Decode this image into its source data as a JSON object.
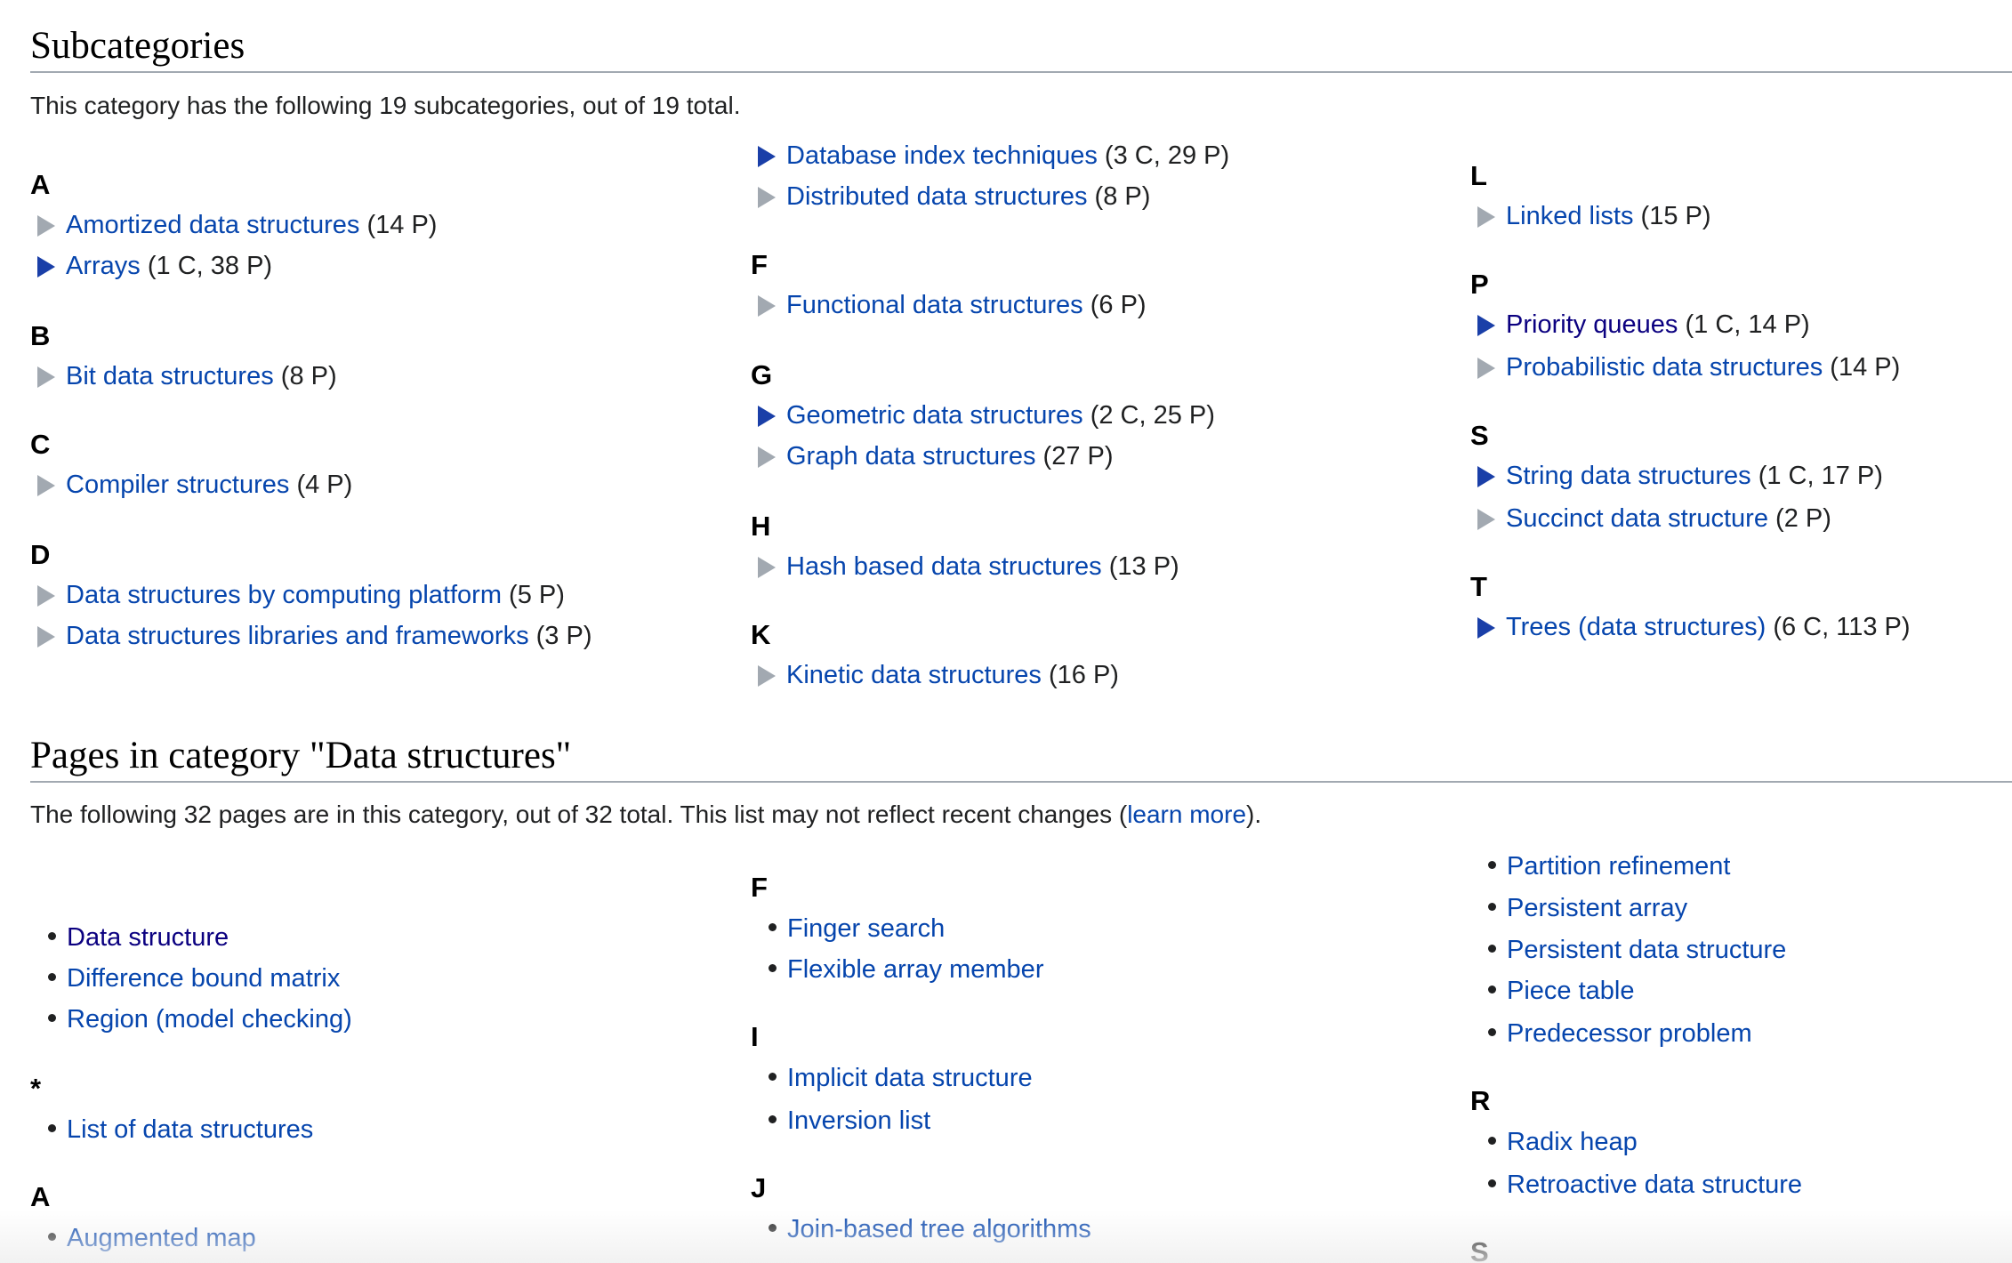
{
  "subcategories": {
    "title": "Subcategories",
    "description": "This category has the following 19 subcategories, out of 19 total.",
    "columns": [
      [
        {
          "letter": "A"
        },
        {
          "label": "Amortized data structures",
          "count": "(14 P)",
          "expandable": false
        },
        {
          "label": "Arrays",
          "count": "(1 C, 38 P)",
          "expandable": true
        },
        {
          "letter": "B"
        },
        {
          "label": "Bit data structures",
          "count": "(8 P)",
          "expandable": false
        },
        {
          "letter": "C"
        },
        {
          "label": "Compiler structures",
          "count": "(4 P)",
          "expandable": false
        },
        {
          "letter": "D"
        },
        {
          "label": "Data structures by computing platform",
          "count": "(5 P)",
          "expandable": false
        },
        {
          "label": "Data structures libraries and frameworks",
          "count": "(3 P)",
          "expandable": false
        }
      ],
      [
        {
          "label": "Database index techniques",
          "count": "(3 C, 29 P)",
          "expandable": true
        },
        {
          "label": "Distributed data structures",
          "count": "(8 P)",
          "expandable": false
        },
        {
          "letter": "F"
        },
        {
          "label": "Functional data structures",
          "count": "(6 P)",
          "expandable": false
        },
        {
          "letter": "G"
        },
        {
          "label": "Geometric data structures",
          "count": "(2 C, 25 P)",
          "expandable": true
        },
        {
          "label": "Graph data structures",
          "count": "(27 P)",
          "expandable": false
        },
        {
          "letter": "H"
        },
        {
          "label": "Hash based data structures",
          "count": "(13 P)",
          "expandable": false
        },
        {
          "letter": "K"
        },
        {
          "label": "Kinetic data structures",
          "count": "(16 P)",
          "expandable": false
        }
      ],
      [
        {
          "letter": "L"
        },
        {
          "label": "Linked lists",
          "count": "(15 P)",
          "expandable": false
        },
        {
          "letter": "P"
        },
        {
          "label": "Priority queues",
          "count": "(1 C, 14 P)",
          "expandable": true,
          "visited": true
        },
        {
          "label": "Probabilistic data structures",
          "count": "(14 P)",
          "expandable": false
        },
        {
          "letter": "S"
        },
        {
          "label": "String data structures",
          "count": "(1 C, 17 P)",
          "expandable": true
        },
        {
          "label": "Succinct data structure",
          "count": "(2 P)",
          "expandable": false
        },
        {
          "letter": "T"
        },
        {
          "label": "Trees (data structures)",
          "count": "(6 C, 113 P)",
          "expandable": true
        }
      ]
    ]
  },
  "pages": {
    "title": "Pages in category \"Data structures\"",
    "description_prefix": "The following 32 pages are in this category, out of 32 total. This list may not reflect recent changes (",
    "description_link": "learn more",
    "description_suffix": ").",
    "columns": [
      [
        {
          "label": "Data structure",
          "visited": true
        },
        {
          "label": "Difference bound matrix"
        },
        {
          "label": "Region (model checking)"
        },
        {
          "letter": "*"
        },
        {
          "label": "List of data structures"
        },
        {
          "letter": "A"
        },
        {
          "label": "Augmented map"
        }
      ],
      [
        {
          "letter": "F"
        },
        {
          "label": "Finger search"
        },
        {
          "label": "Flexible array member"
        },
        {
          "letter": "I"
        },
        {
          "label": "Implicit data structure"
        },
        {
          "label": "Inversion list"
        },
        {
          "letter": "J"
        },
        {
          "label": "Join-based tree algorithms"
        }
      ],
      [
        {
          "label": "Partition refinement"
        },
        {
          "label": "Persistent array"
        },
        {
          "label": "Persistent data structure"
        },
        {
          "label": "Piece table"
        },
        {
          "label": "Predecessor problem"
        },
        {
          "letter": "R"
        },
        {
          "label": "Radix heap"
        },
        {
          "label": "Retroactive data structure"
        },
        {
          "letter": "S"
        }
      ]
    ]
  }
}
